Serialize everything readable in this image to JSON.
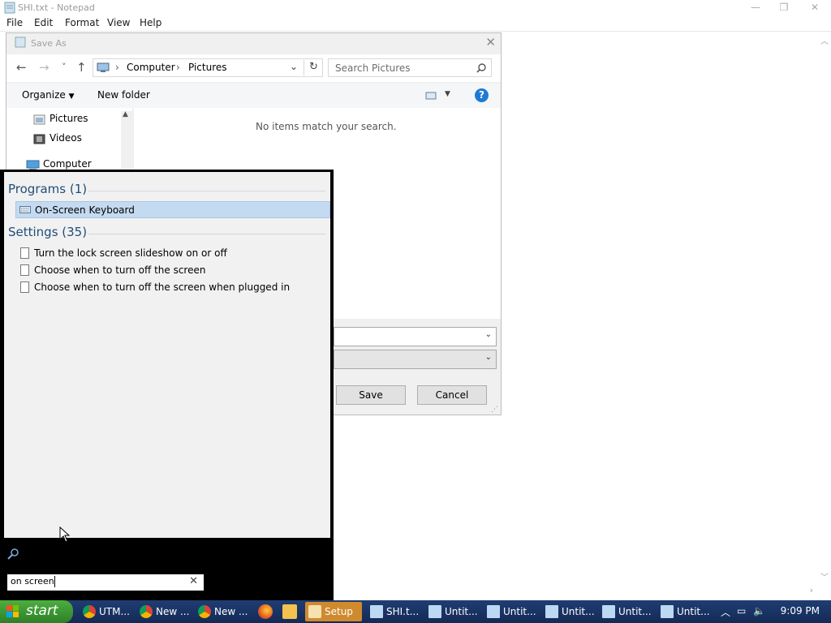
{
  "notepad": {
    "title": "SHI.txt - Notepad",
    "menu": [
      "File",
      "Edit",
      "Format",
      "View",
      "Help"
    ],
    "controls": {
      "minimize": "—",
      "maximize": "❐",
      "close": "✕"
    }
  },
  "save_dialog": {
    "title": "Save As",
    "close": "✕",
    "nav": {
      "back": "←",
      "forward": "→",
      "recent": "˅",
      "up": "↑",
      "refresh": "↻"
    },
    "breadcrumb": [
      "Computer",
      "Pictures"
    ],
    "breadcrumb_sep": "›",
    "search_placeholder": "Search Pictures",
    "toolbar": {
      "organize": "Organize",
      "new_folder": "New folder",
      "help": "?"
    },
    "tree": [
      "Pictures",
      "Videos",
      "Computer"
    ],
    "empty_message": "No items match your search.",
    "buttons": {
      "save": "Save",
      "cancel": "Cancel"
    }
  },
  "start_menu": {
    "programs_header": "Programs (1)",
    "programs": [
      "On-Screen Keyboard"
    ],
    "settings_header": "Settings (35)",
    "settings": [
      "Turn the lock screen slideshow on or off",
      "Choose when to turn off the screen",
      "Choose when to turn off the screen when plugged in"
    ],
    "search_value": "on screen",
    "clear": "✕"
  },
  "taskbar": {
    "start_label": "start",
    "buttons": [
      {
        "label": "UTM...",
        "color": "#db4437"
      },
      {
        "label": "New ...",
        "color": "#db4437"
      },
      {
        "label": "New ...",
        "color": "#db4437"
      },
      {
        "label": "Setup",
        "color": "#d08a2e"
      },
      {
        "label": "SHI.t...",
        "color": "#4a8fd8"
      },
      {
        "label": "Untit...",
        "color": "#4a8fd8"
      },
      {
        "label": "Untit...",
        "color": "#4a8fd8"
      },
      {
        "label": "Untit...",
        "color": "#4a8fd8"
      },
      {
        "label": "Untit...",
        "color": "#4a8fd8"
      },
      {
        "label": "Untit...",
        "color": "#4a8fd8"
      }
    ],
    "clock": "9:09 PM"
  }
}
